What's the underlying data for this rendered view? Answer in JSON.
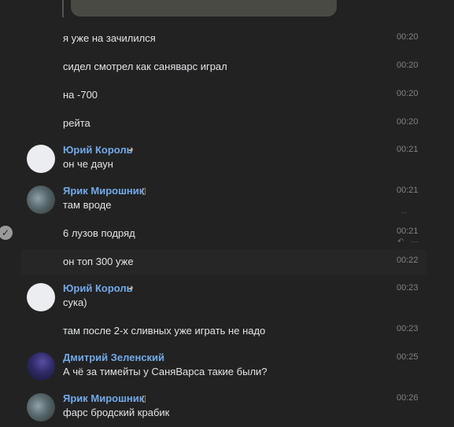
{
  "messages": [
    {
      "text": "я уже на зачилился",
      "time": "00:20"
    },
    {
      "text": "сидел смотрел как саняварс играл",
      "time": "00:20"
    },
    {
      "text": "на -700",
      "time": "00:20"
    },
    {
      "text": "рейта",
      "time": "00:20"
    },
    {
      "author": "Юрий Король",
      "text": "он че даун",
      "time": "00:21"
    },
    {
      "author": "Ярик Мирошник",
      "text": "там вроде",
      "time": "00:21"
    },
    {
      "text": "6 лузов подряд",
      "time": "00:21"
    },
    {
      "text": "он топ 300 уже",
      "time": "00:22"
    },
    {
      "author": "Юрий Король",
      "text": "сука)",
      "time": "00:23"
    },
    {
      "text": "там после 2-х сливных уже играть не надо",
      "time": "00:23"
    },
    {
      "author": "Дмитрий Зеленский",
      "text": "А чё за тимейты у СаняВарса такие были?",
      "time": "00:25"
    },
    {
      "author": "Ярик Мирошник",
      "text": "фарс бродский крабик",
      "time": "00:26"
    }
  ],
  "icons": {
    "check": "check-icon",
    "reply": "reply-icon",
    "more": "more-icon"
  },
  "colors": {
    "background": "#222222",
    "author": "#71aaeb",
    "time": "#828282",
    "text": "#e1e3e6"
  }
}
